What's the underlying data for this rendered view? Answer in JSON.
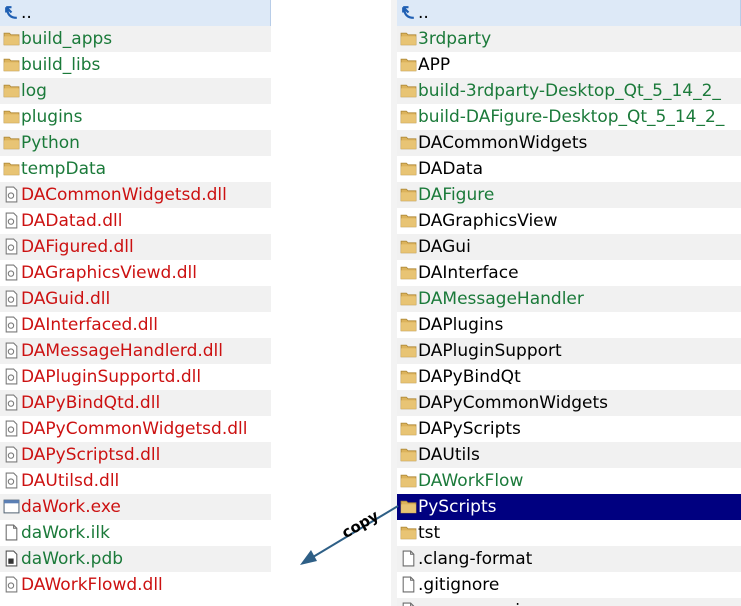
{
  "left_pane": {
    "items": [
      {
        "label": "..",
        "kind": "up",
        "color": "black"
      },
      {
        "label": "build_apps",
        "kind": "folder",
        "color": "green"
      },
      {
        "label": "build_libs",
        "kind": "folder",
        "color": "green"
      },
      {
        "label": "log",
        "kind": "folder",
        "color": "green"
      },
      {
        "label": "plugins",
        "kind": "folder",
        "color": "green"
      },
      {
        "label": "Python",
        "kind": "folder",
        "color": "green"
      },
      {
        "label": "tempData",
        "kind": "folder",
        "color": "green"
      },
      {
        "label": "DACommonWidgetsd.dll",
        "kind": "dll",
        "color": "red"
      },
      {
        "label": "DADatad.dll",
        "kind": "dll",
        "color": "red"
      },
      {
        "label": "DAFigured.dll",
        "kind": "dll",
        "color": "red"
      },
      {
        "label": "DAGraphicsViewd.dll",
        "kind": "dll",
        "color": "red"
      },
      {
        "label": "DAGuid.dll",
        "kind": "dll",
        "color": "red"
      },
      {
        "label": "DAInterfaced.dll",
        "kind": "dll",
        "color": "red"
      },
      {
        "label": "DAMessageHandlerd.dll",
        "kind": "dll",
        "color": "red"
      },
      {
        "label": "DAPluginSupportd.dll",
        "kind": "dll",
        "color": "red"
      },
      {
        "label": "DAPyBindQtd.dll",
        "kind": "dll",
        "color": "red"
      },
      {
        "label": "DAPyCommonWidgetsd.dll",
        "kind": "dll",
        "color": "red"
      },
      {
        "label": "DAPyScriptsd.dll",
        "kind": "dll",
        "color": "red"
      },
      {
        "label": "DAUtilsd.dll",
        "kind": "dll",
        "color": "red"
      },
      {
        "label": "daWork.exe",
        "kind": "exe",
        "color": "red"
      },
      {
        "label": "daWork.ilk",
        "kind": "file",
        "color": "green"
      },
      {
        "label": "daWork.pdb",
        "kind": "pdb",
        "color": "green"
      },
      {
        "label": "DAWorkFlowd.dll",
        "kind": "dll",
        "color": "red"
      }
    ]
  },
  "right_pane": {
    "items": [
      {
        "label": "..",
        "kind": "up",
        "color": "black"
      },
      {
        "label": "3rdparty",
        "kind": "folder",
        "color": "green"
      },
      {
        "label": "APP",
        "kind": "folder",
        "color": "black"
      },
      {
        "label": "build-3rdparty-Desktop_Qt_5_14_2_",
        "kind": "folder",
        "color": "green"
      },
      {
        "label": "build-DAFigure-Desktop_Qt_5_14_2_",
        "kind": "folder",
        "color": "green"
      },
      {
        "label": "DACommonWidgets",
        "kind": "folder",
        "color": "black"
      },
      {
        "label": "DAData",
        "kind": "folder",
        "color": "black"
      },
      {
        "label": "DAFigure",
        "kind": "folder",
        "color": "green"
      },
      {
        "label": "DAGraphicsView",
        "kind": "folder",
        "color": "black"
      },
      {
        "label": "DAGui",
        "kind": "folder",
        "color": "black"
      },
      {
        "label": "DAInterface",
        "kind": "folder",
        "color": "black"
      },
      {
        "label": "DAMessageHandler",
        "kind": "folder",
        "color": "green"
      },
      {
        "label": "DAPlugins",
        "kind": "folder",
        "color": "black"
      },
      {
        "label": "DAPluginSupport",
        "kind": "folder",
        "color": "black"
      },
      {
        "label": "DAPyBindQt",
        "kind": "folder",
        "color": "black"
      },
      {
        "label": "DAPyCommonWidgets",
        "kind": "folder",
        "color": "black"
      },
      {
        "label": "DAPyScripts",
        "kind": "folder",
        "color": "black"
      },
      {
        "label": "DAUtils",
        "kind": "folder",
        "color": "black"
      },
      {
        "label": "DAWorkFlow",
        "kind": "folder",
        "color": "green"
      },
      {
        "label": "PyScripts",
        "kind": "folder",
        "color": "white",
        "selected": true
      },
      {
        "label": "tst",
        "kind": "folder",
        "color": "black"
      },
      {
        "label": ".clang-format",
        "kind": "file",
        "color": "black"
      },
      {
        "label": ".gitignore",
        "kind": "file",
        "color": "black"
      },
      {
        "label": "common.pri",
        "kind": "file",
        "color": "black"
      }
    ]
  },
  "annotation": {
    "label": "copy",
    "color": "#2e5f86"
  },
  "colors": {
    "folder": "#dcb35c",
    "selection": "#000080",
    "green_text": "#1b7a3a",
    "red_text": "#cc1111"
  }
}
